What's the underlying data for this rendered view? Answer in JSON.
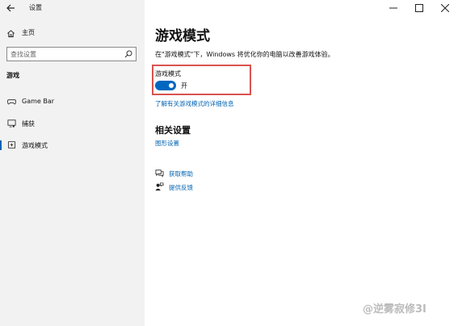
{
  "window": {
    "title": "设置",
    "controls": [
      "minimize",
      "maximize",
      "close"
    ]
  },
  "sidebar": {
    "home_label": "主页",
    "search_placeholder": "查找设置",
    "section_title": "游戏",
    "items": [
      {
        "label": "Game Bar",
        "icon": "gamebar-icon",
        "selected": false
      },
      {
        "label": "捕获",
        "icon": "capture-icon",
        "selected": false
      },
      {
        "label": "游戏模式",
        "icon": "gamemode-icon",
        "selected": true
      }
    ]
  },
  "main": {
    "title": "游戏模式",
    "description": "在\"游戏模式\"下，Windows 将优化你的电脑以改善游戏体验。",
    "toggle": {
      "label": "游戏模式",
      "state_text": "开",
      "on": true,
      "accent": "#0067c0"
    },
    "learn_more_link": "了解有关游戏模式的详细信息",
    "related": {
      "title": "相关设置",
      "graphics_link": "图形设置"
    },
    "help": {
      "get_help": "获取帮助",
      "feedback": "提供反馈"
    }
  },
  "watermark": "@逆雾寂修3I",
  "colors": {
    "accent": "#0063b1",
    "highlight": "#d9534f",
    "sidebar_bg": "#f2f2f2"
  }
}
